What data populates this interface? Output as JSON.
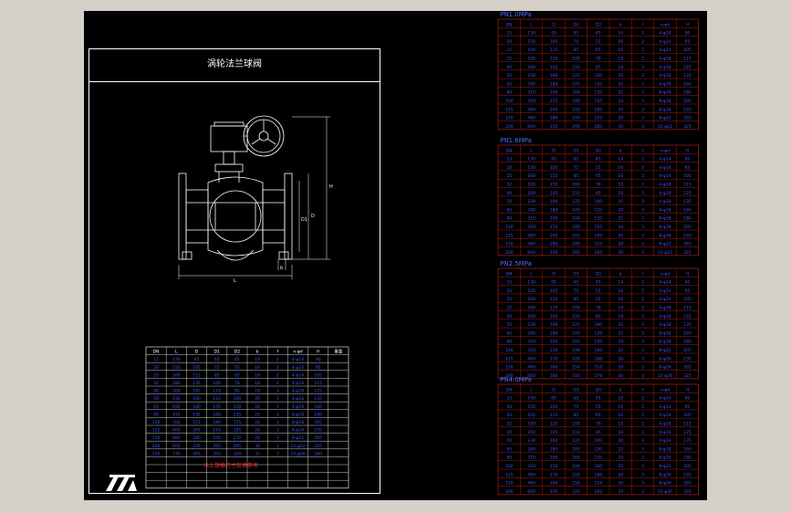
{
  "drawing_title": "涡轮法兰球阀",
  "main_table": {
    "headers": [
      "DN",
      "L",
      "D",
      "D1",
      "D2",
      "b",
      "f",
      "n-φd",
      "H",
      "重量"
    ],
    "rows": [
      [
        "15",
        "130",
        "95",
        "65",
        "45",
        "14",
        "2",
        "4-φ14",
        "90",
        ""
      ],
      [
        "20",
        "150",
        "105",
        "75",
        "55",
        "16",
        "2",
        "4-φ14",
        "95",
        ""
      ],
      [
        "25",
        "160",
        "115",
        "85",
        "65",
        "16",
        "2",
        "4-φ14",
        "105",
        ""
      ],
      [
        "32",
        "180",
        "135",
        "100",
        "78",
        "18",
        "2",
        "4-φ18",
        "115",
        ""
      ],
      [
        "40",
        "200",
        "145",
        "110",
        "85",
        "18",
        "3",
        "4-φ18",
        "125",
        ""
      ],
      [
        "50",
        "230",
        "160",
        "125",
        "100",
        "20",
        "3",
        "4-φ18",
        "135",
        ""
      ],
      [
        "65",
        "290",
        "180",
        "145",
        "120",
        "20",
        "3",
        "4-φ18",
        "160",
        ""
      ],
      [
        "80",
        "310",
        "195",
        "160",
        "135",
        "22",
        "3",
        "8-φ18",
        "180",
        ""
      ],
      [
        "100",
        "350",
        "215",
        "180",
        "155",
        "24",
        "3",
        "8-φ18",
        "205",
        ""
      ],
      [
        "125",
        "400",
        "245",
        "210",
        "185",
        "26",
        "3",
        "8-φ18",
        "235",
        ""
      ],
      [
        "150",
        "480",
        "280",
        "240",
        "210",
        "28",
        "3",
        "8-φ22",
        "265",
        ""
      ],
      [
        "200",
        "600",
        "335",
        "295",
        "265",
        "30",
        "3",
        "12-φ22",
        "325",
        ""
      ],
      [
        "250",
        "730",
        "405",
        "355",
        "320",
        "32",
        "3",
        "12-φ26",
        "380",
        ""
      ]
    ],
    "empty_rows": 4
  },
  "note_text": "以上规格尺寸仅供参考",
  "side_tables": [
    {
      "title": "PN1.0MPa",
      "headers": [
        "DN",
        "L",
        "D",
        "D1",
        "D2",
        "b",
        "f",
        "n-φd",
        "H"
      ],
      "rows": [
        [
          "15",
          "130",
          "95",
          "65",
          "45",
          "14",
          "2",
          "4-φ14",
          "90"
        ],
        [
          "20",
          "150",
          "105",
          "75",
          "55",
          "16",
          "2",
          "4-φ14",
          "95"
        ],
        [
          "25",
          "160",
          "115",
          "85",
          "65",
          "16",
          "2",
          "4-φ14",
          "105"
        ],
        [
          "32",
          "180",
          "135",
          "100",
          "78",
          "18",
          "2",
          "4-φ18",
          "115"
        ],
        [
          "40",
          "200",
          "145",
          "110",
          "85",
          "18",
          "3",
          "4-φ18",
          "125"
        ],
        [
          "50",
          "230",
          "160",
          "125",
          "100",
          "20",
          "3",
          "4-φ18",
          "135"
        ],
        [
          "65",
          "290",
          "180",
          "145",
          "120",
          "20",
          "3",
          "4-φ18",
          "160"
        ],
        [
          "80",
          "310",
          "195",
          "160",
          "135",
          "22",
          "3",
          "8-φ18",
          "180"
        ],
        [
          "100",
          "350",
          "215",
          "180",
          "155",
          "24",
          "3",
          "8-φ18",
          "205"
        ],
        [
          "125",
          "400",
          "245",
          "210",
          "185",
          "26",
          "3",
          "8-φ18",
          "235"
        ],
        [
          "150",
          "480",
          "280",
          "240",
          "210",
          "28",
          "3",
          "8-φ22",
          "265"
        ],
        [
          "200",
          "600",
          "335",
          "295",
          "265",
          "30",
          "3",
          "12-φ22",
          "325"
        ]
      ]
    },
    {
      "title": "PN1.6MPa",
      "headers": [
        "DN",
        "L",
        "D",
        "D1",
        "D2",
        "b",
        "f",
        "n-φd",
        "H"
      ],
      "rows": [
        [
          "15",
          "130",
          "95",
          "65",
          "45",
          "14",
          "2",
          "4-φ14",
          "90"
        ],
        [
          "20",
          "150",
          "105",
          "75",
          "55",
          "16",
          "2",
          "4-φ14",
          "95"
        ],
        [
          "25",
          "160",
          "115",
          "85",
          "65",
          "16",
          "2",
          "4-φ14",
          "105"
        ],
        [
          "32",
          "180",
          "135",
          "100",
          "78",
          "18",
          "2",
          "4-φ18",
          "115"
        ],
        [
          "40",
          "200",
          "145",
          "110",
          "85",
          "18",
          "3",
          "4-φ18",
          "125"
        ],
        [
          "50",
          "230",
          "160",
          "125",
          "100",
          "20",
          "3",
          "4-φ18",
          "135"
        ],
        [
          "65",
          "290",
          "180",
          "145",
          "120",
          "20",
          "3",
          "4-φ18",
          "160"
        ],
        [
          "80",
          "310",
          "195",
          "160",
          "135",
          "22",
          "3",
          "8-φ18",
          "180"
        ],
        [
          "100",
          "350",
          "215",
          "180",
          "155",
          "24",
          "3",
          "8-φ18",
          "205"
        ],
        [
          "125",
          "400",
          "245",
          "210",
          "185",
          "26",
          "3",
          "8-φ18",
          "235"
        ],
        [
          "150",
          "480",
          "280",
          "240",
          "210",
          "28",
          "3",
          "8-φ22",
          "265"
        ],
        [
          "200",
          "600",
          "335",
          "295",
          "265",
          "30",
          "3",
          "12-φ22",
          "325"
        ]
      ]
    },
    {
      "title": "PN2.5MPa",
      "headers": [
        "DN",
        "L",
        "D",
        "D1",
        "D2",
        "b",
        "f",
        "n-φd",
        "H"
      ],
      "rows": [
        [
          "15",
          "130",
          "95",
          "65",
          "45",
          "14",
          "2",
          "4-φ14",
          "90"
        ],
        [
          "20",
          "150",
          "105",
          "75",
          "55",
          "16",
          "2",
          "4-φ14",
          "95"
        ],
        [
          "25",
          "160",
          "115",
          "85",
          "65",
          "16",
          "2",
          "4-φ14",
          "105"
        ],
        [
          "32",
          "180",
          "135",
          "100",
          "78",
          "18",
          "2",
          "4-φ18",
          "115"
        ],
        [
          "40",
          "200",
          "145",
          "110",
          "85",
          "18",
          "3",
          "4-φ18",
          "125"
        ],
        [
          "50",
          "230",
          "160",
          "125",
          "100",
          "20",
          "3",
          "4-φ18",
          "135"
        ],
        [
          "65",
          "290",
          "180",
          "145",
          "120",
          "22",
          "3",
          "8-φ18",
          "160"
        ],
        [
          "80",
          "310",
          "195",
          "160",
          "135",
          "24",
          "3",
          "8-φ18",
          "180"
        ],
        [
          "100",
          "350",
          "230",
          "190",
          "160",
          "24",
          "3",
          "8-φ22",
          "205"
        ],
        [
          "125",
          "400",
          "270",
          "220",
          "188",
          "26",
          "3",
          "8-φ26",
          "235"
        ],
        [
          "150",
          "480",
          "300",
          "250",
          "218",
          "28",
          "3",
          "8-φ26",
          "265"
        ],
        [
          "200",
          "600",
          "360",
          "310",
          "278",
          "30",
          "3",
          "12-φ26",
          "325"
        ]
      ]
    },
    {
      "title": "PN4.0MPa",
      "headers": [
        "DN",
        "L",
        "D",
        "D1",
        "D2",
        "b",
        "f",
        "n-φd",
        "H"
      ],
      "rows": [
        [
          "15",
          "140",
          "95",
          "65",
          "45",
          "16",
          "2",
          "4-φ14",
          "90"
        ],
        [
          "20",
          "150",
          "105",
          "75",
          "55",
          "16",
          "2",
          "4-φ14",
          "95"
        ],
        [
          "25",
          "165",
          "115",
          "85",
          "65",
          "16",
          "2",
          "4-φ14",
          "105"
        ],
        [
          "32",
          "180",
          "135",
          "100",
          "78",
          "18",
          "2",
          "4-φ18",
          "115"
        ],
        [
          "40",
          "200",
          "145",
          "110",
          "85",
          "18",
          "3",
          "4-φ18",
          "125"
        ],
        [
          "50",
          "230",
          "160",
          "125",
          "100",
          "20",
          "3",
          "4-φ18",
          "135"
        ],
        [
          "65",
          "290",
          "180",
          "145",
          "120",
          "22",
          "3",
          "8-φ18",
          "160"
        ],
        [
          "80",
          "310",
          "195",
          "160",
          "135",
          "24",
          "3",
          "8-φ18",
          "180"
        ],
        [
          "100",
          "350",
          "230",
          "190",
          "160",
          "24",
          "3",
          "8-φ22",
          "205"
        ],
        [
          "125",
          "400",
          "270",
          "220",
          "188",
          "28",
          "3",
          "8-φ26",
          "235"
        ],
        [
          "150",
          "480",
          "300",
          "250",
          "218",
          "30",
          "3",
          "8-φ26",
          "265"
        ],
        [
          "200",
          "600",
          "375",
          "320",
          "282",
          "34",
          "3",
          "12-φ30",
          "325"
        ]
      ]
    }
  ],
  "dimension_labels": {
    "length": "L",
    "height": "H",
    "d1": "D1",
    "d": "D",
    "b": "b"
  },
  "colors": {
    "background": "#000000",
    "window": "#d4d0c8",
    "grid_red": "#d21e1e",
    "text_blue": "#3a56ff",
    "line_white": "#ffffff"
  }
}
